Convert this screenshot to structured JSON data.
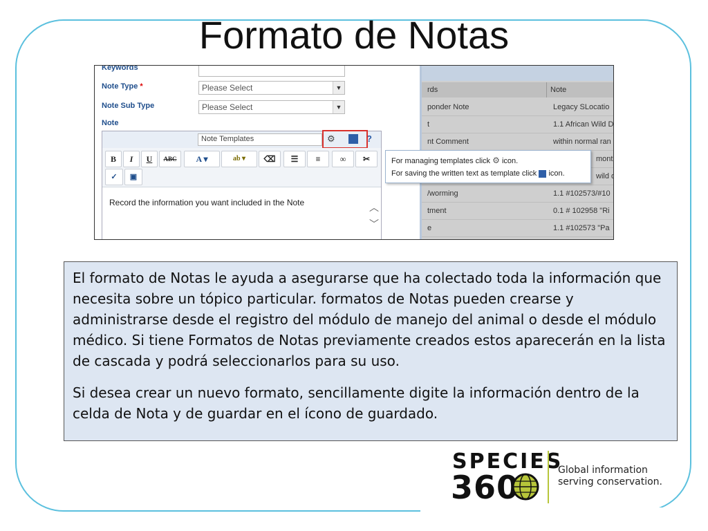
{
  "slide": {
    "title": "Formato de Notas"
  },
  "form": {
    "keywords_label": "Keywords",
    "note_type_label": "Note Type",
    "required_mark": "*",
    "note_type_placeholder": "Please Select",
    "note_sub_type_label": "Note Sub Type",
    "note_sub_type_placeholder": "Please Select",
    "note_label": "Note",
    "templates_placeholder": "Note Templates",
    "editor_text": "Record the information you want included in the Note"
  },
  "tooltip": {
    "line1": "For managing templates click",
    "line1_suffix": "icon.",
    "line2": "For saving the written text as template click",
    "line2_suffix": "icon."
  },
  "grid": {
    "headers": [
      "rds",
      "Note"
    ],
    "rows": [
      [
        "ponder Note",
        "Legacy SLocatio"
      ],
      [
        "t",
        "1.1 African Wild D"
      ],
      [
        "nt Comment",
        "within normal ran"
      ],
      [
        "",
        "monthl"
      ],
      [
        "",
        "wild d"
      ],
      [
        "/worming",
        "1.1 #102573/#10"
      ],
      [
        "tment",
        "0.1 # 102958 \"Ri"
      ],
      [
        "e",
        "1.1 #102573 \"Pa"
      ]
    ]
  },
  "description": {
    "paragraph1": "El formato de Notas le ayuda a asegurarse que ha colectado toda la información que necesita sobre un tópico particular. formatos de Notas pueden crearse  y administrarse desde el registro del módulo de manejo del animal o desde el módulo médico. Si tiene Formatos de Notas previamente creados estos aparecerán en la lista de cascada y podrá seleccionarlos para su uso.",
    "paragraph2": "Si desea crear un nuevo formato, sencillamente digite la información dentro de la celda de Nota y de guardar en el ícono de guardado."
  },
  "logo": {
    "word": "SPECIES",
    "number": "360",
    "tagline_1": "Global information",
    "tagline_2": "serving conservation."
  },
  "colors": {
    "frame": "#5bc0de",
    "highlight": "#d9302c",
    "label": "#1f4e8c",
    "textbox_bg": "#dde6f2",
    "logo_accent": "#b7c63a"
  }
}
